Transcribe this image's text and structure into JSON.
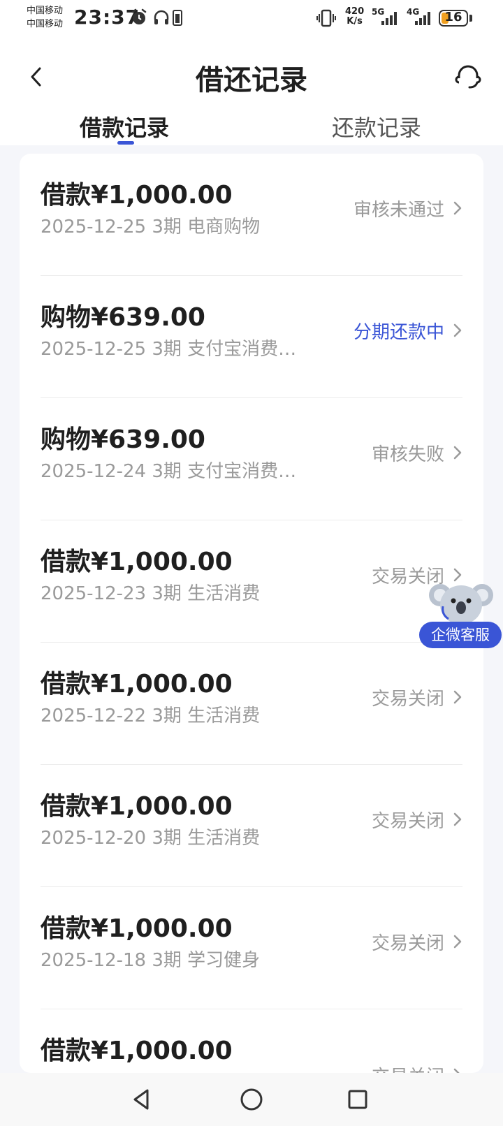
{
  "status_bar": {
    "carrier_1": "中国移动",
    "carrier_2": "中国移动",
    "time": "23:37",
    "speed_value": "420",
    "speed_unit": "K/s",
    "net_5g": "5G",
    "net_4g": "4G",
    "battery": "16",
    "icons": [
      "alarm-icon",
      "headphones-icon",
      "battery-small-icon",
      "vibrate-icon",
      "signal-icon"
    ]
  },
  "header": {
    "title": "借还记录",
    "back_icon": "chevron-left-icon",
    "service_icon": "headset-icon"
  },
  "tabs": [
    {
      "label": "借款记录",
      "active": true
    },
    {
      "label": "还款记录",
      "active": false
    }
  ],
  "records": [
    {
      "title": "借款¥1,000.00",
      "subtitle": "2025-12-25 3期  电商购物",
      "status": "审核未通过",
      "status_active": false
    },
    {
      "title": "购物¥639.00",
      "subtitle": "2025-12-25 3期  支付宝消费…",
      "status": "分期还款中",
      "status_active": true
    },
    {
      "title": "购物¥639.00",
      "subtitle": "2025-12-24 3期  支付宝消费…",
      "status": "审核失败",
      "status_active": false
    },
    {
      "title": "借款¥1,000.00",
      "subtitle": "2025-12-23 3期  生活消费",
      "status": "交易关闭",
      "status_active": false
    },
    {
      "title": "借款¥1,000.00",
      "subtitle": "2025-12-22 3期  生活消费",
      "status": "交易关闭",
      "status_active": false
    },
    {
      "title": "借款¥1,000.00",
      "subtitle": "2025-12-20 3期  生活消费",
      "status": "交易关闭",
      "status_active": false
    },
    {
      "title": "借款¥1,000.00",
      "subtitle": "2025-12-18 3期  学习健身",
      "status": "交易关闭",
      "status_active": false
    },
    {
      "title": "借款¥1,000.00",
      "subtitle": "",
      "status": "交易关闭",
      "status_active": false
    }
  ],
  "float_service": {
    "label": "企微客服",
    "icon": "koala-mascot-icon"
  },
  "colors": {
    "accent": "#3a55d6",
    "muted_text": "#9a9a9a",
    "page_bg": "#f5f6fa"
  },
  "navbar": {
    "icons": [
      "back-triangle-icon",
      "home-circle-icon",
      "recents-square-icon"
    ]
  }
}
